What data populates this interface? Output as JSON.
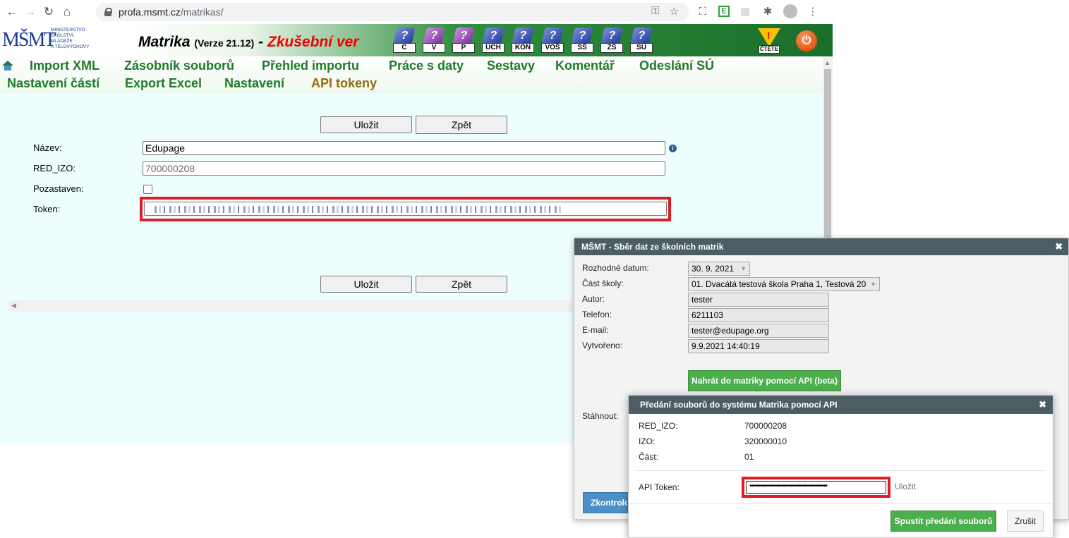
{
  "browser": {
    "url_host": "profa.msmt.cz",
    "url_path": "/matrikas/"
  },
  "header": {
    "logo_text": "MŠMT",
    "ministry_lines": [
      "MINISTERSTVO",
      "ŠKOLSTVÍ,",
      "MLÁDEŽE",
      "A TĚLOVÝCHOVY"
    ],
    "title": "Matrika",
    "version": "(Verze 21.12)",
    "dash": "-",
    "trial": "Zkušební ver",
    "icons": [
      {
        "label": "C",
        "color": "blue"
      },
      {
        "label": "V",
        "color": "purple"
      },
      {
        "label": "P",
        "color": "purple"
      },
      {
        "label": "UCH",
        "color": "blue"
      },
      {
        "label": "KON",
        "color": "blue"
      },
      {
        "label": "VOŠ",
        "color": "blue"
      },
      {
        "label": "SŠ",
        "color": "blue"
      },
      {
        "label": "ZŠ",
        "color": "blue"
      },
      {
        "label": "SÚ",
        "color": "blue"
      }
    ],
    "warn_label": "ČTĚTE"
  },
  "menu": {
    "row1": [
      "Import XML",
      "Zásobník souborů",
      "Přehled importu",
      "Práce s daty",
      "Sestavy",
      "Komentář",
      "Odeslání SÚ"
    ],
    "row2": [
      "Nastavení částí",
      "Export Excel",
      "Nastavení",
      "API tokeny"
    ],
    "active": "API tokeny"
  },
  "form": {
    "save": "Uložit",
    "back": "Zpět",
    "name_label": "Název:",
    "name_value": "Edupage",
    "redizo_label": "RED_IZO:",
    "redizo_value": "700000208",
    "paused_label": "Pozastaven:",
    "token_label": "Token:"
  },
  "dialog1": {
    "title": "MŠMT - Sběr dat ze školních matrik",
    "close": "✖",
    "rows": [
      {
        "label": "Rozhodné datum:",
        "value": "30. 9. 2021"
      },
      {
        "label": "Část školy:",
        "value": "01. Dvacátá testová škola Praha 1, Testová 20"
      },
      {
        "label": "Autor:",
        "value": "tester"
      },
      {
        "label": "Telefon:",
        "value": "6211103"
      },
      {
        "label": "E-mail:",
        "value": "tester@edupage.org"
      },
      {
        "label": "Vytvořeno:",
        "value": "9.9.2021 14:40:19"
      }
    ],
    "upload_button": "Nahrát do matriky pomocí API (beta)",
    "download_label": "Stáhnout:",
    "check_button": "Zkontrolovat"
  },
  "dialog2": {
    "title": "Předání souborů do systému Matrika pomocí API",
    "close": "✖",
    "rows": [
      {
        "label": "RED_IZO:",
        "value": "700000208"
      },
      {
        "label": "IZO:",
        "value": "320000010"
      },
      {
        "label": "Část:",
        "value": "01"
      }
    ],
    "api_token_label": "API Token:",
    "api_token_value": "••••••••••••••••••••••••••••••••••••••••••••",
    "save_link": "Uložit",
    "start_button": "Spustit předání souborů",
    "cancel_button": "Zrušit"
  }
}
